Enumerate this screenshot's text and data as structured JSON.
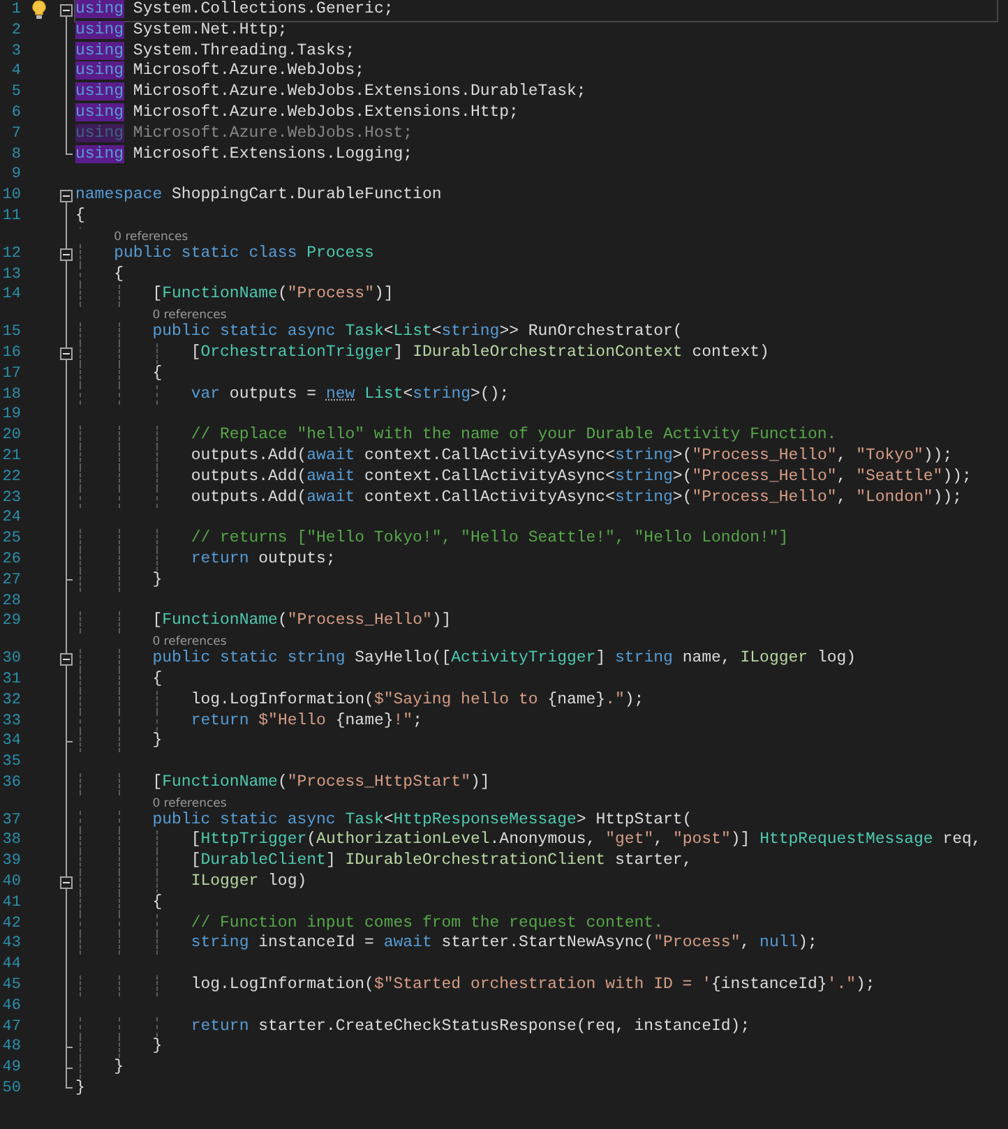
{
  "editor": {
    "lines": [
      {
        "number": "1",
        "current": true,
        "lightbulb": true,
        "fold": {
          "expanded": true
        },
        "tokens": [
          {
            "kind": "keyword",
            "text": "using",
            "highlight": true
          },
          {
            "kind": "plain",
            "text": " System.Collections.Generic;"
          }
        ]
      },
      {
        "number": "2",
        "tokens": [
          {
            "kind": "keyword",
            "text": "using",
            "highlight": true
          },
          {
            "kind": "plain",
            "text": " System.Net.Http;"
          }
        ]
      },
      {
        "number": "3",
        "tokens": [
          {
            "kind": "keyword",
            "text": "using",
            "highlight": true
          },
          {
            "kind": "plain",
            "text": " System.Threading.Tasks;"
          }
        ]
      },
      {
        "number": "4",
        "tokens": [
          {
            "kind": "keyword",
            "text": "using",
            "highlight": true
          },
          {
            "kind": "plain",
            "text": " Microsoft.Azure.WebJobs;"
          }
        ]
      },
      {
        "number": "5",
        "tokens": [
          {
            "kind": "keyword",
            "text": "using",
            "highlight": true
          },
          {
            "kind": "plain",
            "text": " Microsoft.Azure.WebJobs.Extensions.DurableTask;"
          }
        ]
      },
      {
        "number": "6",
        "tokens": [
          {
            "kind": "keyword",
            "text": "using",
            "highlight": true
          },
          {
            "kind": "plain",
            "text": " Microsoft.Azure.WebJobs.Extensions.Http;"
          }
        ]
      },
      {
        "number": "7",
        "faded": true,
        "tokens": [
          {
            "kind": "keyword",
            "text": "using",
            "highlight": true
          },
          {
            "kind": "plain",
            "text": " Microsoft.Azure.WebJobs.Host;"
          }
        ]
      },
      {
        "number": "8",
        "fold_end": true,
        "tokens": [
          {
            "kind": "keyword",
            "text": "using",
            "highlight": true
          },
          {
            "kind": "plain",
            "text": " Microsoft.Extensions.Logging;"
          }
        ]
      },
      {
        "number": "9"
      },
      {
        "number": "10",
        "fold": {
          "expanded": true
        },
        "tokens": [
          {
            "kind": "keyword",
            "text": "namespace"
          },
          {
            "kind": "plain",
            "text": " ShoppingCart.DurableFunction"
          }
        ]
      },
      {
        "number": "11",
        "tokens": [
          {
            "kind": "plain",
            "text": "{"
          }
        ]
      },
      {
        "number": "12",
        "lens": "0 references",
        "fold": {
          "expanded": true
        },
        "tokens": [
          {
            "kind": "keyword",
            "text": "    public static class"
          },
          {
            "kind": "type",
            "text": " Process"
          }
        ]
      },
      {
        "number": "13",
        "tokens": [
          {
            "kind": "plain",
            "text": "    {"
          }
        ]
      },
      {
        "number": "14",
        "tokens": [
          {
            "kind": "plain",
            "text": "        ["
          },
          {
            "kind": "type",
            "text": "FunctionName"
          },
          {
            "kind": "plain",
            "text": "("
          },
          {
            "kind": "string",
            "text": "\"Process\""
          },
          {
            "kind": "plain",
            "text": ")]"
          }
        ]
      },
      {
        "number": "15",
        "lens": "0 references",
        "tokens": [
          {
            "kind": "keyword",
            "text": "        public static async"
          },
          {
            "kind": "type",
            "text": " Task"
          },
          {
            "kind": "plain",
            "text": "<"
          },
          {
            "kind": "type",
            "text": "List"
          },
          {
            "kind": "plain",
            "text": "<"
          },
          {
            "kind": "keyword",
            "text": "string"
          },
          {
            "kind": "plain",
            "text": ">> RunOrchestrator("
          }
        ]
      },
      {
        "number": "16",
        "fold": {
          "expanded": true
        },
        "tokens": [
          {
            "kind": "plain",
            "text": "            ["
          },
          {
            "kind": "type",
            "text": "OrchestrationTrigger"
          },
          {
            "kind": "plain",
            "text": "] "
          },
          {
            "kind": "interface",
            "text": "IDurableOrchestrationContext"
          },
          {
            "kind": "plain",
            "text": " context)"
          }
        ]
      },
      {
        "number": "17",
        "tokens": [
          {
            "kind": "plain",
            "text": "        {"
          }
        ]
      },
      {
        "number": "18",
        "tokens": [
          {
            "kind": "keyword",
            "text": "            var"
          },
          {
            "kind": "plain",
            "text": " outputs = "
          },
          {
            "kind": "keyword",
            "text": "new",
            "hint": true
          },
          {
            "kind": "type",
            "text": " List"
          },
          {
            "kind": "plain",
            "text": "<"
          },
          {
            "kind": "keyword",
            "text": "string"
          },
          {
            "kind": "plain",
            "text": ">();"
          }
        ]
      },
      {
        "number": "19"
      },
      {
        "number": "20",
        "tokens": [
          {
            "kind": "comment",
            "text": "            // Replace \"hello\" with the name of your Durable Activity Function."
          }
        ]
      },
      {
        "number": "21",
        "tokens": [
          {
            "kind": "plain",
            "text": "            outputs.Add("
          },
          {
            "kind": "keyword",
            "text": "await"
          },
          {
            "kind": "plain",
            "text": " context.CallActivityAsync<"
          },
          {
            "kind": "keyword",
            "text": "string"
          },
          {
            "kind": "plain",
            "text": ">("
          },
          {
            "kind": "string",
            "text": "\"Process_Hello\""
          },
          {
            "kind": "plain",
            "text": ", "
          },
          {
            "kind": "string",
            "text": "\"Tokyo\""
          },
          {
            "kind": "plain",
            "text": "));"
          }
        ]
      },
      {
        "number": "22",
        "tokens": [
          {
            "kind": "plain",
            "text": "            outputs.Add("
          },
          {
            "kind": "keyword",
            "text": "await"
          },
          {
            "kind": "plain",
            "text": " context.CallActivityAsync<"
          },
          {
            "kind": "keyword",
            "text": "string"
          },
          {
            "kind": "plain",
            "text": ">("
          },
          {
            "kind": "string",
            "text": "\"Process_Hello\""
          },
          {
            "kind": "plain",
            "text": ", "
          },
          {
            "kind": "string",
            "text": "\"Seattle\""
          },
          {
            "kind": "plain",
            "text": "));"
          }
        ]
      },
      {
        "number": "23",
        "tokens": [
          {
            "kind": "plain",
            "text": "            outputs.Add("
          },
          {
            "kind": "keyword",
            "text": "await"
          },
          {
            "kind": "plain",
            "text": " context.CallActivityAsync<"
          },
          {
            "kind": "keyword",
            "text": "string"
          },
          {
            "kind": "plain",
            "text": ">("
          },
          {
            "kind": "string",
            "text": "\"Process_Hello\""
          },
          {
            "kind": "plain",
            "text": ", "
          },
          {
            "kind": "string",
            "text": "\"London\""
          },
          {
            "kind": "plain",
            "text": "));"
          }
        ]
      },
      {
        "number": "24"
      },
      {
        "number": "25",
        "tokens": [
          {
            "kind": "comment",
            "text": "            // returns [\"Hello Tokyo!\", \"Hello Seattle!\", \"Hello London!\"]"
          }
        ]
      },
      {
        "number": "26",
        "tokens": [
          {
            "kind": "keyword",
            "text": "            return"
          },
          {
            "kind": "plain",
            "text": " outputs;"
          }
        ]
      },
      {
        "number": "27",
        "fold_end": true,
        "tokens": [
          {
            "kind": "plain",
            "text": "        }"
          }
        ]
      },
      {
        "number": "28"
      },
      {
        "number": "29",
        "tokens": [
          {
            "kind": "plain",
            "text": "        ["
          },
          {
            "kind": "type",
            "text": "FunctionName"
          },
          {
            "kind": "plain",
            "text": "("
          },
          {
            "kind": "string",
            "text": "\"Process_Hello\""
          },
          {
            "kind": "plain",
            "text": ")]"
          }
        ]
      },
      {
        "number": "30",
        "lens": "0 references",
        "fold": {
          "expanded": true
        },
        "tokens": [
          {
            "kind": "keyword",
            "text": "        public static string"
          },
          {
            "kind": "plain",
            "text": " SayHello(["
          },
          {
            "kind": "type",
            "text": "ActivityTrigger"
          },
          {
            "kind": "plain",
            "text": "] "
          },
          {
            "kind": "keyword",
            "text": "string"
          },
          {
            "kind": "plain",
            "text": " name, "
          },
          {
            "kind": "interface",
            "text": "ILogger"
          },
          {
            "kind": "plain",
            "text": " log)"
          }
        ]
      },
      {
        "number": "31",
        "tokens": [
          {
            "kind": "plain",
            "text": "        {"
          }
        ]
      },
      {
        "number": "32",
        "tokens": [
          {
            "kind": "plain",
            "text": "            log.LogInformation("
          },
          {
            "kind": "string",
            "text": "$\"Saying hello to "
          },
          {
            "kind": "plain",
            "text": "{name}"
          },
          {
            "kind": "string",
            "text": ".\""
          },
          {
            "kind": "plain",
            "text": ");"
          }
        ]
      },
      {
        "number": "33",
        "tokens": [
          {
            "kind": "keyword",
            "text": "            return"
          },
          {
            "kind": "string",
            "text": " $\"Hello "
          },
          {
            "kind": "plain",
            "text": "{name}"
          },
          {
            "kind": "string",
            "text": "!\""
          },
          {
            "kind": "plain",
            "text": ";"
          }
        ]
      },
      {
        "number": "34",
        "fold_end": true,
        "tokens": [
          {
            "kind": "plain",
            "text": "        }"
          }
        ]
      },
      {
        "number": "35"
      },
      {
        "number": "36",
        "tokens": [
          {
            "kind": "plain",
            "text": "        ["
          },
          {
            "kind": "type",
            "text": "FunctionName"
          },
          {
            "kind": "plain",
            "text": "("
          },
          {
            "kind": "string",
            "text": "\"Process_HttpStart\""
          },
          {
            "kind": "plain",
            "text": ")]"
          }
        ]
      },
      {
        "number": "37",
        "lens": "0 references",
        "tokens": [
          {
            "kind": "keyword",
            "text": "        public static async"
          },
          {
            "kind": "type",
            "text": " Task"
          },
          {
            "kind": "plain",
            "text": "<"
          },
          {
            "kind": "type",
            "text": "HttpResponseMessage"
          },
          {
            "kind": "plain",
            "text": "> HttpStart("
          }
        ]
      },
      {
        "number": "38",
        "tokens": [
          {
            "kind": "plain",
            "text": "            ["
          },
          {
            "kind": "type",
            "text": "HttpTrigger"
          },
          {
            "kind": "plain",
            "text": "("
          },
          {
            "kind": "interface",
            "text": "AuthorizationLevel"
          },
          {
            "kind": "plain",
            "text": ".Anonymous, "
          },
          {
            "kind": "string",
            "text": "\"get\""
          },
          {
            "kind": "plain",
            "text": ", "
          },
          {
            "kind": "string",
            "text": "\"post\""
          },
          {
            "kind": "plain",
            "text": ")] "
          },
          {
            "kind": "type",
            "text": "HttpRequestMessage"
          },
          {
            "kind": "plain",
            "text": " req,"
          }
        ]
      },
      {
        "number": "39",
        "tokens": [
          {
            "kind": "plain",
            "text": "            ["
          },
          {
            "kind": "type",
            "text": "DurableClient"
          },
          {
            "kind": "plain",
            "text": "] "
          },
          {
            "kind": "interface",
            "text": "IDurableOrchestrationClient"
          },
          {
            "kind": "plain",
            "text": " starter,"
          }
        ]
      },
      {
        "number": "40",
        "fold": {
          "expanded": true
        },
        "tokens": [
          {
            "kind": "interface",
            "text": "            ILogger"
          },
          {
            "kind": "plain",
            "text": " log)"
          }
        ]
      },
      {
        "number": "41",
        "tokens": [
          {
            "kind": "plain",
            "text": "        {"
          }
        ]
      },
      {
        "number": "42",
        "tokens": [
          {
            "kind": "comment",
            "text": "            // Function input comes from the request content."
          }
        ]
      },
      {
        "number": "43",
        "tokens": [
          {
            "kind": "keyword",
            "text": "            string"
          },
          {
            "kind": "plain",
            "text": " instanceId = "
          },
          {
            "kind": "keyword",
            "text": "await"
          },
          {
            "kind": "plain",
            "text": " starter.StartNewAsync("
          },
          {
            "kind": "string",
            "text": "\"Process\""
          },
          {
            "kind": "plain",
            "text": ", "
          },
          {
            "kind": "keyword",
            "text": "null"
          },
          {
            "kind": "plain",
            "text": ");"
          }
        ]
      },
      {
        "number": "44"
      },
      {
        "number": "45",
        "tokens": [
          {
            "kind": "plain",
            "text": "            log.LogInformation("
          },
          {
            "kind": "string",
            "text": "$\"Started orchestration with ID = '"
          },
          {
            "kind": "plain",
            "text": "{instanceId}"
          },
          {
            "kind": "string",
            "text": "'.\""
          },
          {
            "kind": "plain",
            "text": ");"
          }
        ]
      },
      {
        "number": "46"
      },
      {
        "number": "47",
        "tokens": [
          {
            "kind": "keyword",
            "text": "            return"
          },
          {
            "kind": "plain",
            "text": " starter.CreateCheckStatusResponse(req, instanceId);"
          }
        ]
      },
      {
        "number": "48",
        "fold_end": true,
        "tokens": [
          {
            "kind": "plain",
            "text": "        }"
          }
        ]
      },
      {
        "number": "49",
        "fold_end": true,
        "tokens": [
          {
            "kind": "plain",
            "text": "    }"
          }
        ]
      },
      {
        "number": "50",
        "fold_end": true,
        "tokens": [
          {
            "kind": "plain",
            "text": "}"
          }
        ]
      }
    ]
  }
}
